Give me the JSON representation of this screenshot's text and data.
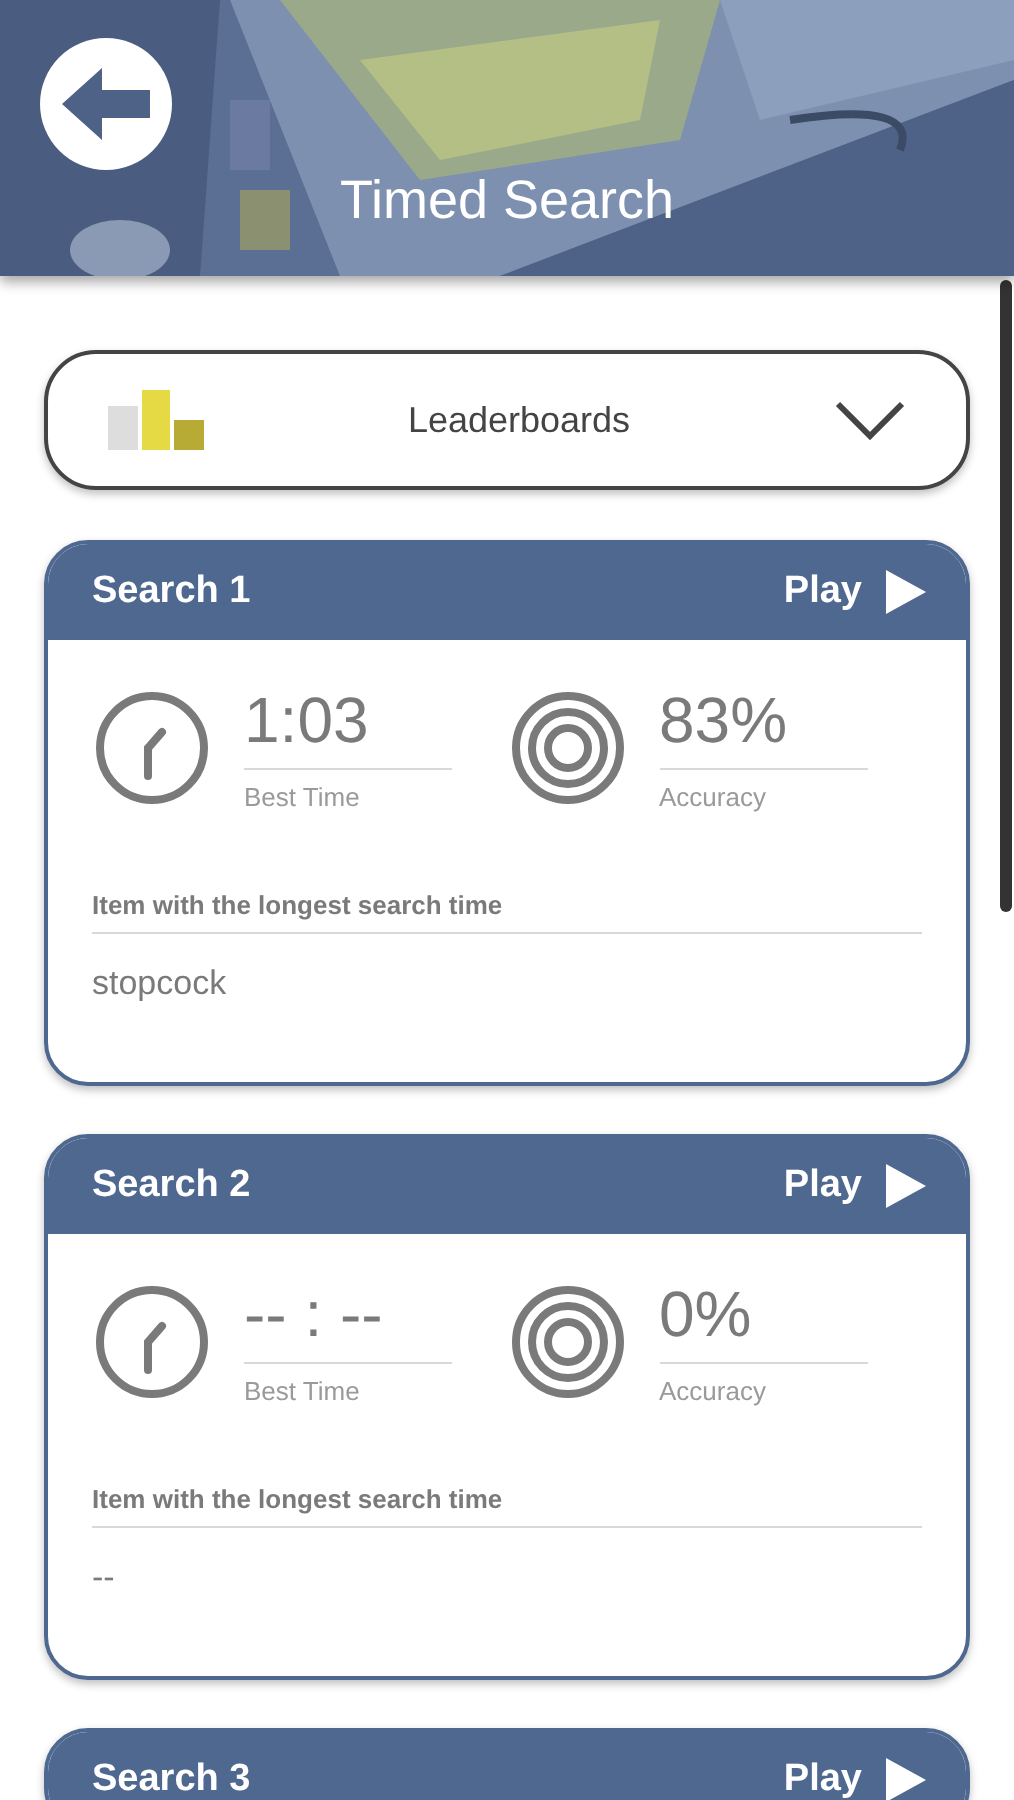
{
  "header": {
    "title": "Timed Search"
  },
  "dropdown": {
    "label": "Leaderboards",
    "expanded": false
  },
  "searches": [
    {
      "title": "Search 1",
      "play": "Play",
      "best_time": "1:03",
      "best_time_label": "Best Time",
      "accuracy": "83%",
      "accuracy_label": "Accuracy",
      "longest_label": "Item with the longest search time",
      "longest_item": "stopcock"
    },
    {
      "title": "Search 2",
      "play": "Play",
      "best_time": "-- : --",
      "best_time_label": "Best Time",
      "accuracy": "0%",
      "accuracy_label": "Accuracy",
      "longest_label": "Item with the longest search time",
      "longest_item": "--"
    },
    {
      "title": "Search 3",
      "play": "Play"
    }
  ]
}
